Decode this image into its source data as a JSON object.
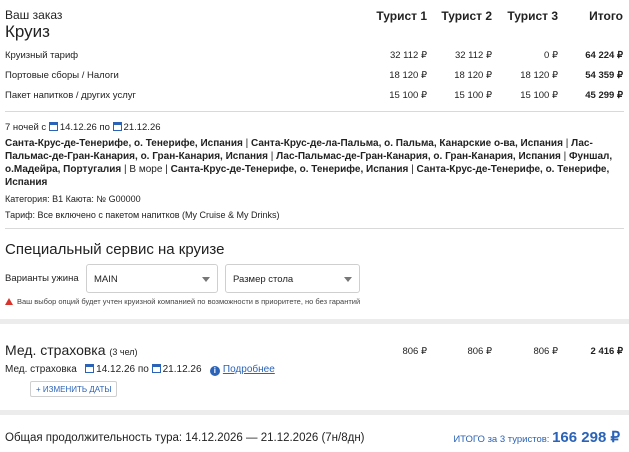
{
  "order": {
    "title": "Ваш заказ",
    "subtitle": "Круиз"
  },
  "columns": [
    "Турист 1",
    "Турист 2",
    "Турист 3",
    "Итого"
  ],
  "price_rows": [
    {
      "label": "Круизный тариф",
      "values": [
        "32 112 ₽",
        "32 112 ₽",
        "0 ₽",
        "64 224 ₽"
      ]
    },
    {
      "label": "Портовые сборы / Налоги",
      "values": [
        "18 120 ₽",
        "18 120 ₽",
        "18 120 ₽",
        "54 359 ₽"
      ]
    },
    {
      "label": "Пакет напитков / других услуг",
      "values": [
        "15 100 ₽",
        "15 100 ₽",
        "15 100 ₽",
        "45 299 ₽"
      ]
    }
  ],
  "trip": {
    "nights": "7 ночей с",
    "date_from": "14.12.26",
    "by": "по",
    "date_to": "21.12.26",
    "route": [
      {
        "text": "Санта-Крус-де-Тенерифе, о. Тенерифе, Испания",
        "bold": true
      },
      {
        "text": "Санта-Крус-де-ла-Пальма, о. Пальма, Канарские о-ва, Испания",
        "bold": true
      },
      {
        "text": "Лас-Пальмас-де-Гран-Канария, о. Гран-Канария, Испания",
        "bold": true
      },
      {
        "text": "Лас-Пальмас-де-Гран-Канария, о. Гран-Канария, Испания",
        "bold": true
      },
      {
        "text": "Фуншал, о.Мадейра, Португалия",
        "bold": true
      },
      {
        "text": "В море",
        "bold": false
      },
      {
        "text": "Санта-Крус-де-Тенерифе, о. Тенерифе, Испания",
        "bold": true
      },
      {
        "text": "Санта-Крус-де-Тенерифе, о. Тенерифе, Испания",
        "bold": true
      }
    ],
    "category": "Категория: B1   Каюта: № G00000",
    "tariff": "Тариф: Все включено с пакетом напитков (My Cruise & My Drinks)"
  },
  "special": {
    "title": "Специальный сервис на круизе",
    "dinner_label": "Варианты ужина",
    "dinner_value": "MAIN",
    "table_value": "Размер стола",
    "warning": "Ваш выбор опций будет учтен круизной компанией по возможности в приоритете, но без гарантий"
  },
  "insurance": {
    "title": "Мед. страховка",
    "count": "(3 чел)",
    "values": [
      "806 ₽",
      "806 ₽",
      "806 ₽",
      "2 416 ₽"
    ],
    "line_label": "Мед. страховка",
    "date_from": "14.12.26",
    "by": "по",
    "date_to": "21.12.26",
    "details_link": "Подробнее",
    "change_button": "ИЗМЕНИТЬ ДАТЫ"
  },
  "footer": {
    "duration": "Общая продолжительность тура: 14.12.2026 — 21.12.2026 (7н/8дн)",
    "total_label": "ИТОГО",
    "total_for": "за 3 туристов:",
    "total_value": "166 298 ₽"
  },
  "colors": {
    "accent": "#2a63b8",
    "warning": "#d9342b",
    "divider": "#d9d9d9"
  }
}
